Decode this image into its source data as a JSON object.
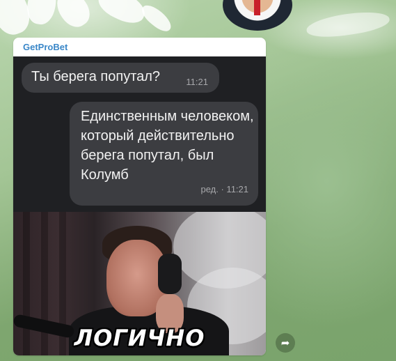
{
  "channel": {
    "name": "GetProBet"
  },
  "conversation": {
    "incoming": {
      "text": "Ты берега попутал?",
      "time": "11:21"
    },
    "outgoing": {
      "text": "Единственным человеком, который действительно берега попутал, был Колумб",
      "meta": "ред. · 11:21"
    }
  },
  "media": {
    "caption": "ЛОГИЧНО"
  },
  "icons": {
    "share": "share-arrow-icon"
  },
  "colors": {
    "channel_name": "#3a87c8",
    "bubble": "#3c3d41",
    "dark_bg": "#1f2023"
  }
}
